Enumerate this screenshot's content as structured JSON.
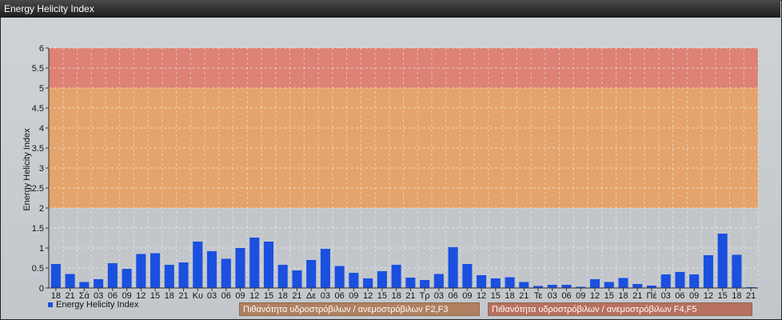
{
  "window": {
    "title": "Energy Helicity Index"
  },
  "chart_data": {
    "type": "bar",
    "ylabel": "Energy Helicity Index",
    "ylim": [
      0,
      6
    ],
    "yticks": [
      "0",
      "0.5",
      "1",
      "1.5",
      "2",
      "2.5",
      "3",
      "3.5",
      "4",
      "4.5",
      "5",
      "5.5",
      "6"
    ],
    "grid": true,
    "legend_position": "bottom-left",
    "series": [
      {
        "name": "Energy Helicity Index",
        "color": "#1a4fe0",
        "values": [
          0.6,
          0.35,
          0.15,
          0.22,
          0.62,
          0.48,
          0.85,
          0.87,
          0.58,
          0.64,
          1.16,
          0.92,
          0.73,
          1.0,
          1.26,
          1.16,
          0.58,
          0.44,
          0.7,
          0.98,
          0.55,
          0.38,
          0.24,
          0.42,
          0.58,
          0.26,
          0.2,
          0.35,
          1.02,
          0.6,
          0.32,
          0.24,
          0.27,
          0.15,
          0.05,
          0.08,
          0.08,
          0.03,
          0.22,
          0.15,
          0.25,
          0.1,
          0.06,
          0.34,
          0.4,
          0.34,
          0.82,
          1.36,
          0.83,
          0.02
        ]
      }
    ],
    "categories": [
      "18",
      "21",
      "Σά",
      "03",
      "06",
      "09",
      "12",
      "15",
      "18",
      "21",
      "Κυ",
      "03",
      "06",
      "09",
      "12",
      "15",
      "18",
      "21",
      "Δε",
      "03",
      "06",
      "09",
      "12",
      "15",
      "18",
      "21",
      "Τρ",
      "03",
      "06",
      "09",
      "12",
      "15",
      "18",
      "21",
      "Τε",
      "03",
      "06",
      "09",
      "12",
      "15",
      "18",
      "21",
      "Πέ",
      "03",
      "06",
      "09",
      "12",
      "15",
      "18",
      "21"
    ],
    "bands": [
      {
        "from": 2,
        "to": 5,
        "color": "#e8a060",
        "label": "Πιθανότητα υδροστρόβιλων / ανεμοστρόβιλων F2,F3"
      },
      {
        "from": 5,
        "to": 6,
        "color": "#e07a6a",
        "label": "Πιθανότητα υδροστρόβιλων / ανεμοστρόβιλων F4,F5"
      }
    ]
  }
}
